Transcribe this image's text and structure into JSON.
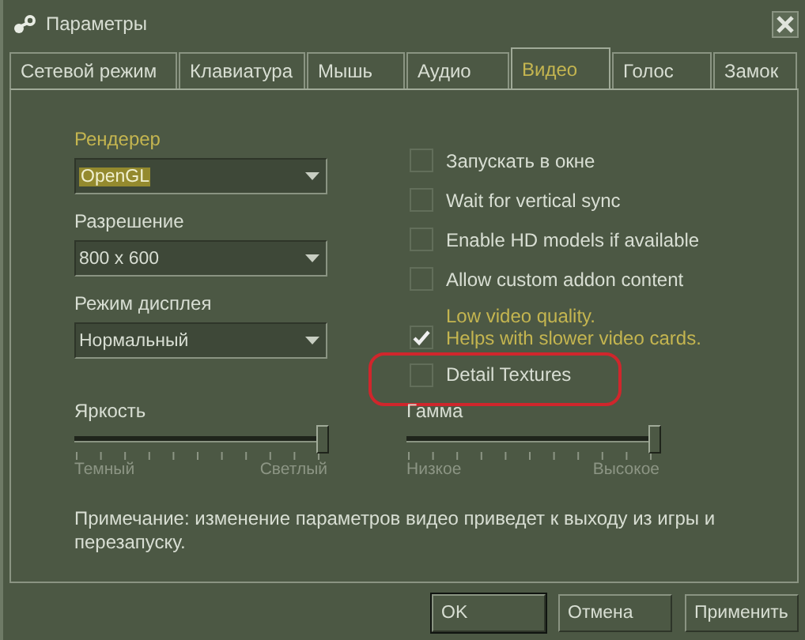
{
  "window": {
    "title": "Параметры"
  },
  "tabs": [
    {
      "label": "Сетевой режим",
      "selected": false
    },
    {
      "label": "Клавиатура",
      "selected": false
    },
    {
      "label": "Мышь",
      "selected": false
    },
    {
      "label": "Аудио",
      "selected": false
    },
    {
      "label": "Видео",
      "selected": true
    },
    {
      "label": "Голос",
      "selected": false
    },
    {
      "label": "Замок",
      "selected": false
    }
  ],
  "dropdowns": [
    {
      "label": "Рендерер",
      "value": "OpenGL",
      "focused": true
    },
    {
      "label": "Разрешение",
      "value": "800 x 600",
      "focused": false
    },
    {
      "label": "Режим дисплея",
      "value": "Нормальный",
      "focused": false
    }
  ],
  "checkboxes": [
    {
      "label": "Запускать в окне",
      "checked": false,
      "accent": false
    },
    {
      "label": "Wait for vertical sync",
      "checked": false,
      "accent": false
    },
    {
      "label": "Enable HD models if available",
      "checked": false,
      "accent": false
    },
    {
      "label": "Allow custom addon content",
      "checked": false,
      "accent": false
    },
    {
      "label": "Low video quality.\nHelps with slower video cards.",
      "checked": true,
      "accent": true
    },
    {
      "label": "Detail Textures",
      "checked": false,
      "accent": false,
      "circled": true
    }
  ],
  "sliders": [
    {
      "label": "Яркость",
      "level": 1,
      "min_label": "Темный",
      "max_label": "Светлый"
    },
    {
      "label": "Гамма",
      "level": 1,
      "min_label": "Низкое",
      "max_label": "Высокое"
    }
  ],
  "note": "Примечание: изменение параметров видео приведет к выходу из игры и перезапуску.",
  "buttons": [
    {
      "label": "OK",
      "default": true
    },
    {
      "label": "Отмена",
      "default": false
    },
    {
      "label": "Применить",
      "default": false
    }
  ]
}
